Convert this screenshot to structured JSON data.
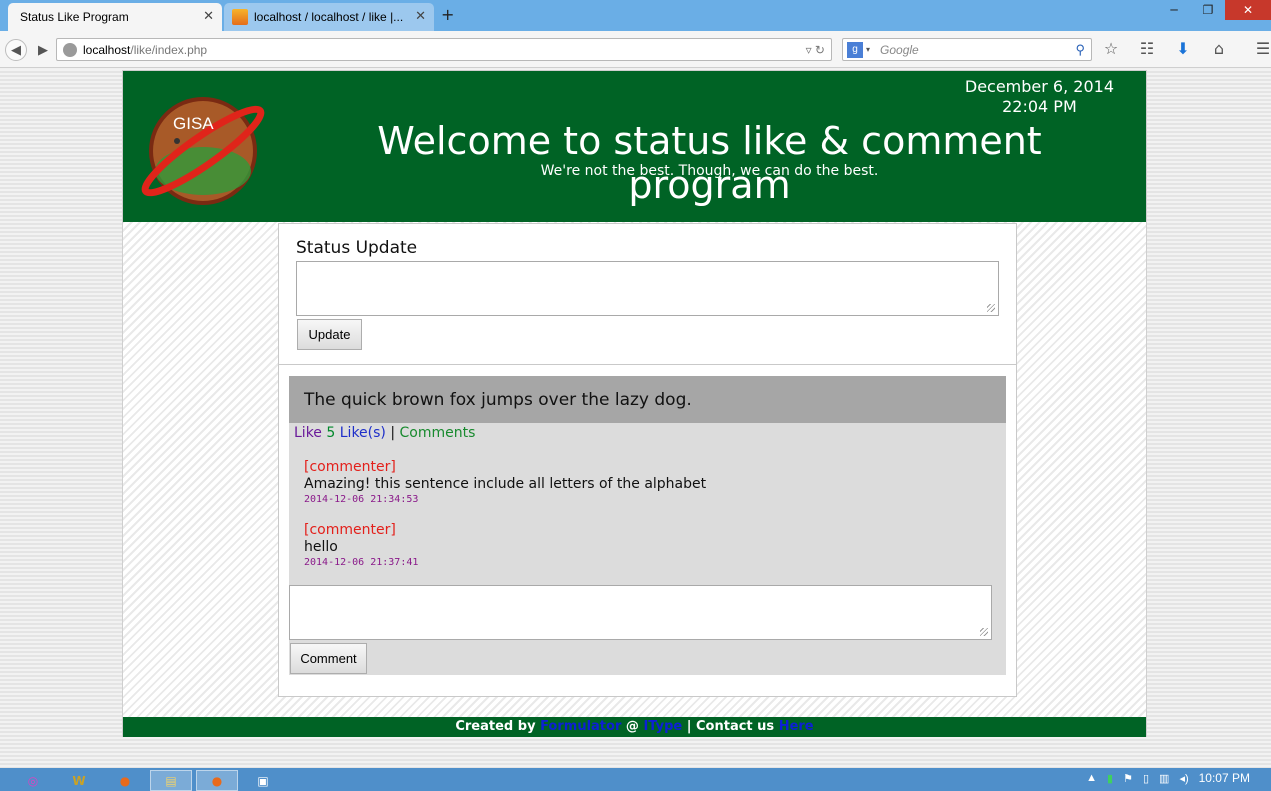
{
  "browser": {
    "tabs": [
      {
        "title": "Status Like Program",
        "active": true
      },
      {
        "title": "localhost / localhost / like |...",
        "active": false
      }
    ],
    "url_host": "localhost",
    "url_path": "/like/index.php",
    "search_placeholder": "Google"
  },
  "header": {
    "logo_text": "GISA",
    "date": "December 6, 2014",
    "time": "22:04 PM",
    "title": "Welcome to status like & comment program",
    "subtitle": "We're not the best. Though, we can do the best."
  },
  "status_form": {
    "label": "Status Update",
    "input_value": "",
    "button_label": "Update"
  },
  "post": {
    "text": "The quick brown fox jumps over the lazy dog.",
    "like_label": "Like",
    "like_count": "5",
    "likes_label": "Like(s)",
    "separator": "|",
    "comments_label": "Comments",
    "comments": [
      {
        "author": "[commenter]",
        "text": "Amazing! this sentence include all letters of the alphabet",
        "timestamp": "2014-12-06 21:34:53"
      },
      {
        "author": "[commenter]",
        "text": "hello",
        "timestamp": "2014-12-06 21:37:41"
      }
    ],
    "comment_input_value": "",
    "comment_button_label": "Comment"
  },
  "footer": {
    "created_by": "Created by",
    "author_link": "Formulator",
    "at": "@",
    "site_link": "IType",
    "sep": "|",
    "contact": "Contact us",
    "contact_link": "Here"
  },
  "taskbar": {
    "clock": "10:07 PM"
  },
  "colors": {
    "header_green": "#006325",
    "comment_author": "#e3201b",
    "timestamp": "#8a1a8a",
    "footer_link": "#0d1fd6"
  }
}
